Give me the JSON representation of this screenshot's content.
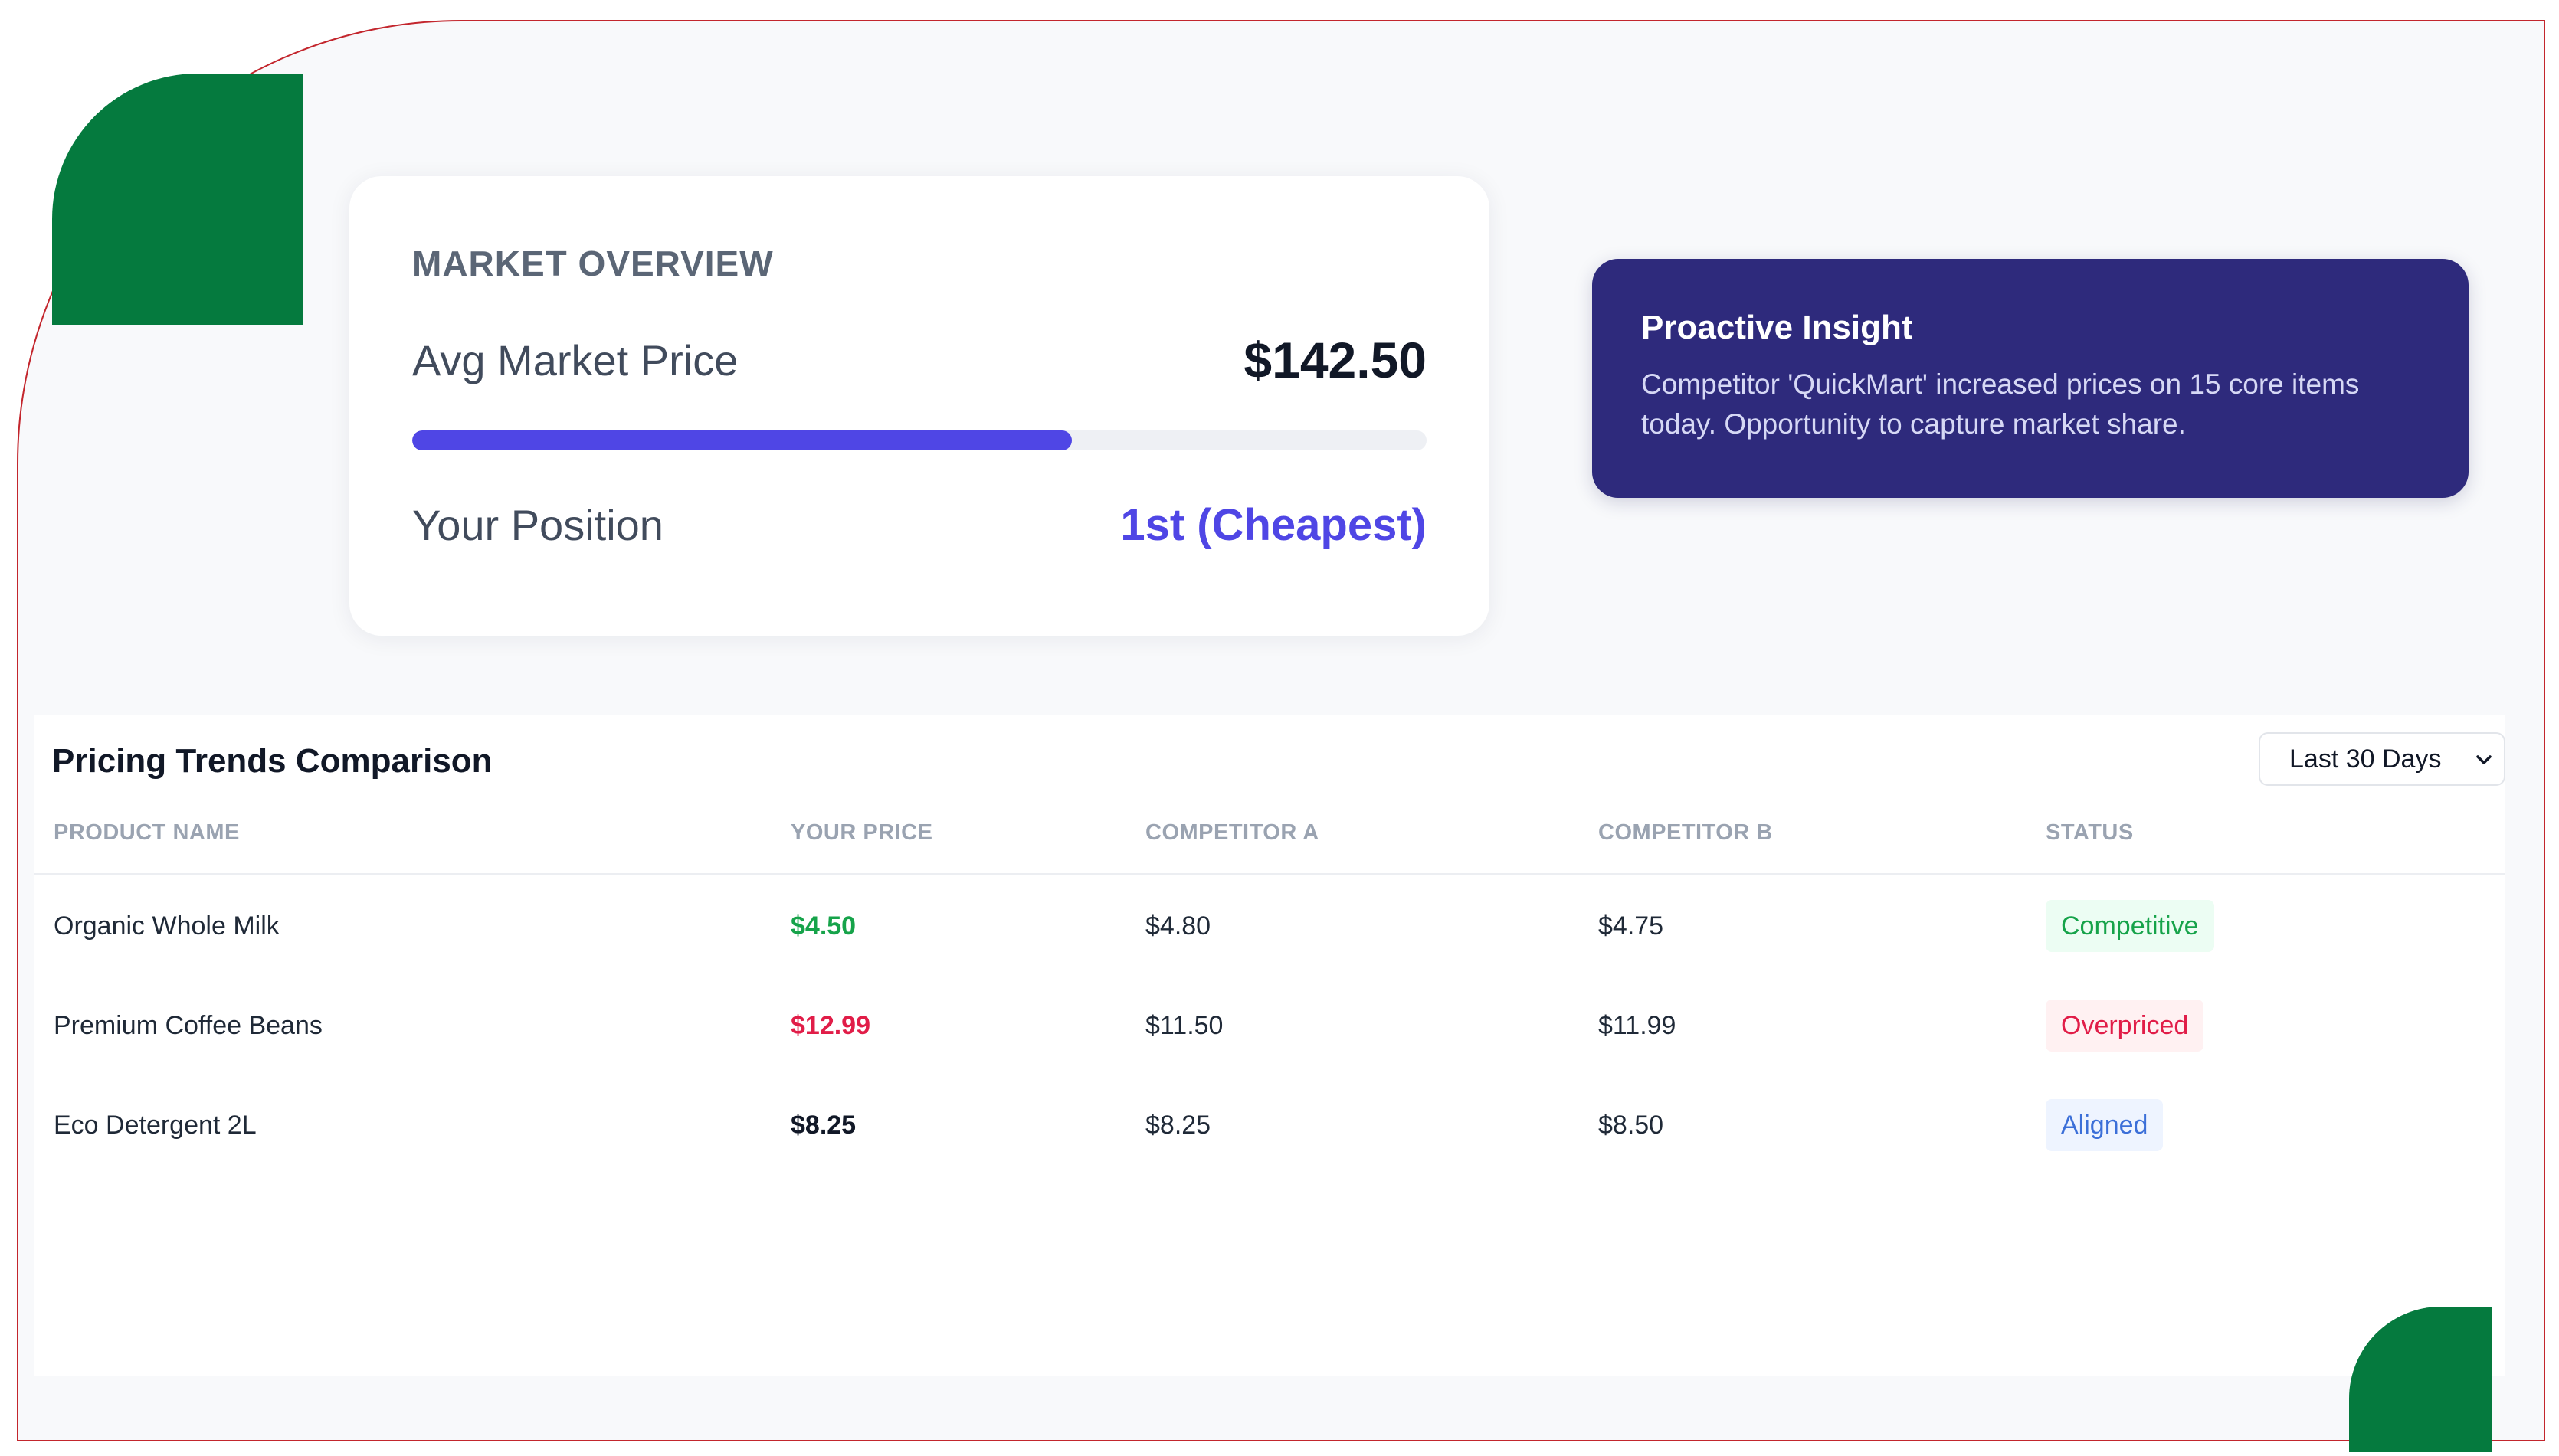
{
  "overview": {
    "title": "MARKET OVERVIEW",
    "avg_label": "Avg Market Price",
    "avg_value": "$142.50",
    "progress_fraction": 0.65,
    "position_label": "Your Position",
    "position_value": "1st (Cheapest)"
  },
  "insight": {
    "title": "Proactive Insight",
    "text": "Competitor 'QuickMart' increased prices on 15 core items today. Opportunity to capture market share."
  },
  "trends": {
    "title": "Pricing Trends Comparison",
    "range_selected": "Last 30 Days",
    "columns": {
      "product": "PRODUCT NAME",
      "your_price": "YOUR PRICE",
      "competitor_a": "COMPETITOR A",
      "competitor_b": "COMPETITOR B",
      "status": "STATUS"
    },
    "rows": [
      {
        "product": "Organic Whole Milk",
        "your_price": "$4.50",
        "competitor_a": "$4.80",
        "competitor_b": "$4.75",
        "status": "Competitive"
      },
      {
        "product": "Premium Coffee Beans",
        "your_price": "$12.99",
        "competitor_a": "$11.50",
        "competitor_b": "$11.99",
        "status": "Overpriced"
      },
      {
        "product": "Eco Detergent 2L",
        "your_price": "$8.25",
        "competitor_a": "$8.25",
        "competitor_b": "$8.50",
        "status": "Aligned"
      }
    ]
  },
  "colors": {
    "accent": "#4f46e5",
    "insight_bg": "#2e2a7c",
    "brand_green": "#057a3e",
    "frame_red": "#c3262d",
    "competitive_text": "#16a34a",
    "competitive_bg": "#ecfdf3",
    "overpriced_text": "#e11d48",
    "overpriced_bg": "#fff1f2",
    "aligned_text": "#3b6fd8",
    "aligned_bg": "#eef4ff",
    "price_default": "#111827"
  }
}
